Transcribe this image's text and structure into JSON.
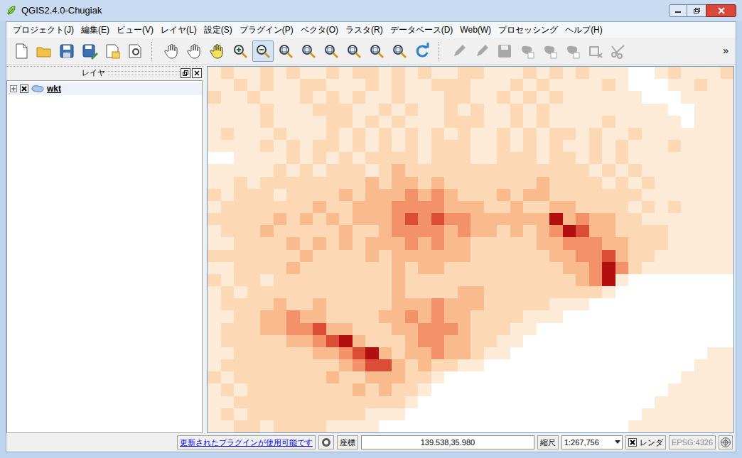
{
  "window": {
    "title": "QGIS2.4.0-Chugiak"
  },
  "menu": [
    "プロジェクト(J)",
    "編集(E)",
    "ビュー(V)",
    "レイヤ(L)",
    "設定(S)",
    "プラグイン(P)",
    "ベクタ(O)",
    "ラスタ(R)",
    "データベース(D)",
    "Web(W)",
    "プロセッシング",
    "ヘルプ(H)"
  ],
  "toolbar": [
    [
      {
        "kind": "new",
        "selected": false,
        "disabled": false
      },
      {
        "kind": "open",
        "selected": false,
        "disabled": false
      },
      {
        "kind": "save",
        "selected": false,
        "disabled": false
      },
      {
        "kind": "saveas",
        "selected": false,
        "disabled": false
      },
      {
        "kind": "print",
        "selected": false,
        "disabled": false
      },
      {
        "kind": "composer",
        "selected": false,
        "disabled": false
      }
    ],
    [
      {
        "kind": "touch",
        "selected": false,
        "disabled": false
      },
      {
        "kind": "pan",
        "selected": false,
        "disabled": false
      },
      {
        "kind": "pan-selected",
        "selected": false,
        "disabled": false
      },
      {
        "kind": "zoom-in",
        "selected": false,
        "disabled": false
      },
      {
        "kind": "zoom-out",
        "selected": true,
        "disabled": false
      },
      {
        "kind": "zoom-native",
        "selected": false,
        "disabled": false
      },
      {
        "kind": "zoom-full",
        "selected": false,
        "disabled": false
      },
      {
        "kind": "zoom-layer",
        "selected": false,
        "disabled": false
      },
      {
        "kind": "zoom-selection",
        "selected": false,
        "disabled": false
      },
      {
        "kind": "zoom-last",
        "selected": false,
        "disabled": false
      },
      {
        "kind": "zoom-next",
        "selected": false,
        "disabled": false
      },
      {
        "kind": "refresh",
        "selected": false,
        "disabled": false
      }
    ],
    [
      {
        "kind": "edit-toggle",
        "selected": false,
        "disabled": true
      },
      {
        "kind": "pencil",
        "selected": false,
        "disabled": true
      },
      {
        "kind": "save-edits",
        "selected": false,
        "disabled": true
      },
      {
        "kind": "add-feature",
        "selected": false,
        "disabled": true
      },
      {
        "kind": "move-feature",
        "selected": false,
        "disabled": true
      },
      {
        "kind": "node-tool",
        "selected": false,
        "disabled": true
      },
      {
        "kind": "delete",
        "selected": false,
        "disabled": true
      },
      {
        "kind": "cut",
        "selected": false,
        "disabled": true
      }
    ]
  ],
  "toolbar_overflow": "»",
  "layers_panel": {
    "title": "レイヤ",
    "layers": [
      {
        "name": "wkt",
        "visible": true,
        "expanded": false,
        "selected": true
      }
    ]
  },
  "map": {
    "cell_classes": [
      "1211212112122121211221112121211100121112",
      "1121211221112121122211121211112100011211",
      "2112111212121121112211212121111110001111",
      "1111211122211212112121121211111111100111",
      "1111211112212121112221121211112111110111",
      "1211121112121212121211212122121121111111",
      "1111212122121212122211212121121211121111",
      "0011112121212222122211222122121211111111",
      "1111121212221232222222222222212121111111",
      "1121222222223233232222222322221212111111",
      "2122212222323334343222323322222221111111",
      "1222222232233344443332232233222212121111",
      "2222232323233345454433333363433221111111",
      "1222322222322344443433232346533222211111",
      "1122223232323334343322222334443322211111",
      "2222222322223233333322222233445322111111",
      "1122223222222232332222222223346421111111",
      "2122122222222232222222222222346100000000",
      "1212222222222232222332222222221000000000",
      "1222232232222233343332222211100000000000",
      "1122334332222334343322221110000000000000",
      "1222334453322233444322211000000000000000",
      "1222223345632223443322110000000000000000",
      "1122222233456323343321100000000000000011",
      "1222222222345532322110000000000000000111",
      "2122222223223332210000000000000000001111",
      "1212222222232322100000000000000000011111",
      "1122222222222221000000000000000000111111",
      "1212222222221110000000000000000001111111",
      "1122122221111000000000000000000011111111"
    ]
  },
  "status_bar": {
    "plugin_notice": "更新されたプラグインが使用可能です",
    "coordinate_label": "座標",
    "coordinate": "139.538,35.980",
    "scale_label": "縮尺",
    "scale": "1:267,756",
    "render_label": "レンダ",
    "render": true,
    "crs": "EPSG:4326",
    "crs_disabled": true
  }
}
